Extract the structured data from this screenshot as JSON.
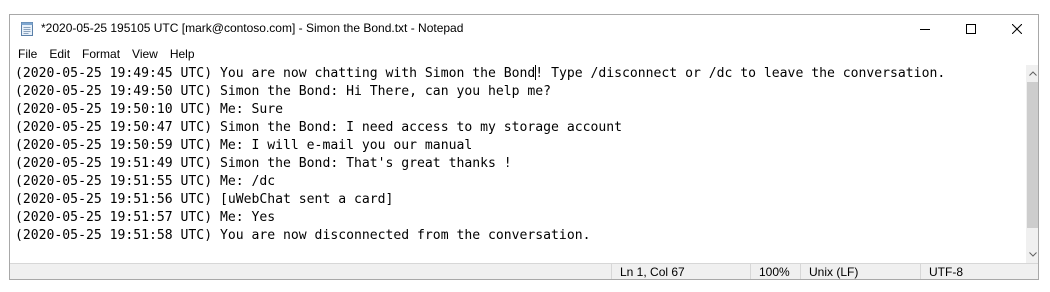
{
  "window": {
    "title": "*2020-05-25 195105 UTC [mark@contoso.com] - Simon the Bond.txt - Notepad"
  },
  "menu": {
    "file": "File",
    "edit": "Edit",
    "format": "Format",
    "view": "View",
    "help": "Help"
  },
  "editor": {
    "lines": [
      {
        "before": "(2020-05-25 19:49:45 UTC) You are now chatting with Simon the Bond",
        "after": "! Type /disconnect or /dc to leave the conversation."
      },
      {
        "text": "(2020-05-25 19:49:50 UTC) Simon the Bond: Hi There, can you help me?"
      },
      {
        "text": "(2020-05-25 19:50:10 UTC) Me: Sure"
      },
      {
        "text": "(2020-05-25 19:50:47 UTC) Simon the Bond: I need access to my storage account"
      },
      {
        "text": "(2020-05-25 19:50:59 UTC) Me: I will e-mail you our manual"
      },
      {
        "text": "(2020-05-25 19:51:49 UTC) Simon the Bond: That's great thanks !"
      },
      {
        "text": "(2020-05-25 19:51:55 UTC) Me: /dc"
      },
      {
        "text": "(2020-05-25 19:51:56 UTC) [uWebChat sent a card]"
      },
      {
        "text": "(2020-05-25 19:51:57 UTC) Me: Yes"
      },
      {
        "text": "(2020-05-25 19:51:58 UTC) You are now disconnected from the conversation."
      }
    ]
  },
  "status": {
    "position": "Ln 1, Col 67",
    "zoom": "100%",
    "line_endings": "Unix (LF)",
    "encoding": "UTF-8"
  },
  "icons": {
    "app": "notepad-icon",
    "minimize": "minimize-icon",
    "maximize": "maximize-icon",
    "close": "close-icon"
  }
}
